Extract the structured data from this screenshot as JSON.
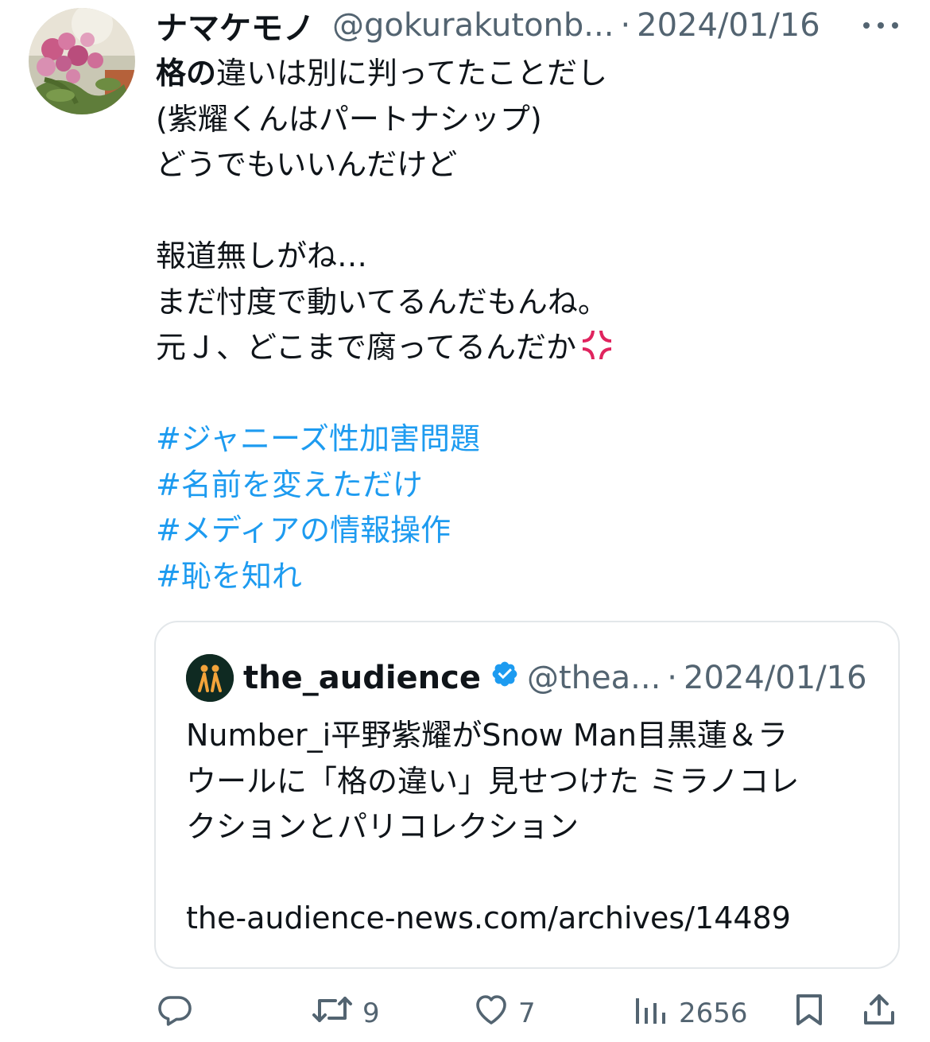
{
  "tweet": {
    "display_name": "ナマケモノ",
    "handle": "@gokurakutonb...",
    "separator": "·",
    "date": "2024/01/16",
    "lines": [
      {
        "bold": "格の",
        "text": "違いは別に判ってたことだし"
      },
      {
        "text": "(紫耀くんはパートナシップ)"
      },
      {
        "text": "どうでもいいんだけど"
      },
      {
        "text": ""
      },
      {
        "text": "報道無しがね…"
      },
      {
        "text": "まだ忖度で動いてるんだもんね。"
      },
      {
        "text": "元Ｊ、どこまで腐ってるんだか"
      },
      {
        "text": ""
      }
    ],
    "hashtags": [
      "#ジャニーズ性加害問題",
      "#名前を変えただけ",
      "#メディアの情報操作",
      "#恥を知れ"
    ]
  },
  "quote": {
    "display_name": "the_audience",
    "handle": "@thea...",
    "separator": "·",
    "date": "2024/01/16",
    "lines": [
      "Number_i平野紫耀がSnow Man目黒蓮＆ラ",
      "ウールに「格の違い」見せつけた ミラノコレ",
      "クションとパリコレクション",
      "",
      "the-audience-news.com/archives/14489"
    ]
  },
  "actions": {
    "reply_icon": "reply-icon",
    "retweet_icon": "retweet-icon",
    "retweets": "9",
    "like_icon": "heart-icon",
    "likes": "7",
    "views_icon": "views-icon",
    "views": "2656",
    "bookmark_icon": "bookmark-icon",
    "share_icon": "share-icon"
  },
  "colors": {
    "hashtag": "#1d9bf0",
    "secondary_text": "#536471",
    "primary_text": "#0f1419",
    "verified": "#1d9bf0",
    "anger_symbol": "#e0245e"
  }
}
